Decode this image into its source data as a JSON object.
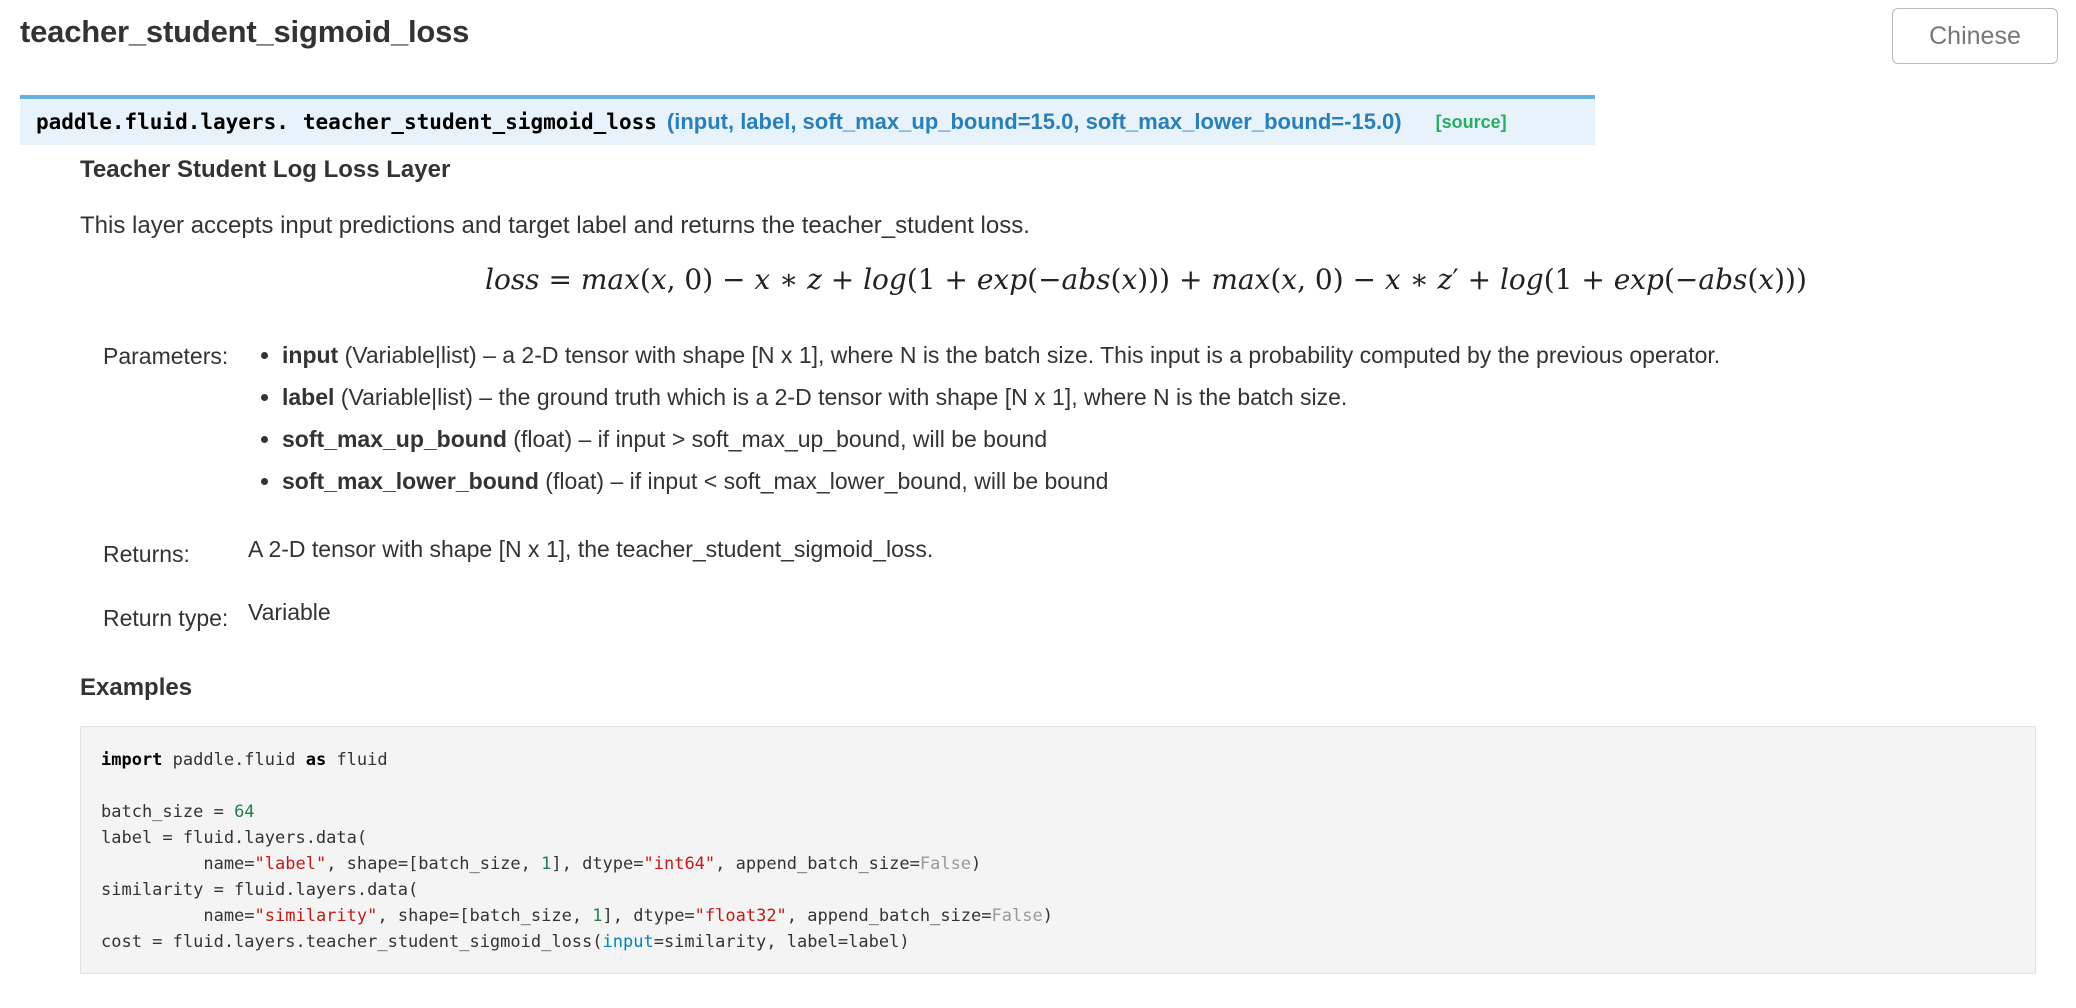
{
  "page": {
    "title": "teacher_student_sigmoid_loss",
    "language_button": "Chinese"
  },
  "signature": {
    "module": "paddle.fluid.layers.",
    "name": "teacher_student_sigmoid_loss",
    "params": "(input, label, soft_max_up_bound=15.0, soft_max_lower_bound=-15.0)",
    "source_link": "[source]"
  },
  "description": {
    "heading": "Teacher Student Log Loss Layer",
    "text": "This layer accepts input predictions and target label and returns the teacher_student loss."
  },
  "formula": "loss = max(x, 0) − x ∗ z + log(1 + exp(−abs(x))) + max(x, 0) − x ∗ z′ + log(1 + exp(−abs(x)))",
  "parameters": {
    "label": "Parameters:",
    "items": [
      {
        "name": "input",
        "desc": " (Variable|list) – a 2-D tensor with shape [N x 1], where N is the batch size. This input is a probability computed by the previous operator."
      },
      {
        "name": "label",
        "desc": " (Variable|list) – the ground truth which is a 2-D tensor with shape [N x 1], where N is the batch size."
      },
      {
        "name": "soft_max_up_bound",
        "desc": " (float) – if input > soft_max_up_bound, will be bound"
      },
      {
        "name": "soft_max_lower_bound",
        "desc": " (float) – if input < soft_max_lower_bound, will be bound"
      }
    ]
  },
  "returns": {
    "label": "Returns:",
    "value": "A 2-D tensor with shape [N x 1], the teacher_student_sigmoid_loss."
  },
  "return_type": {
    "label": "Return type:",
    "value": "Variable"
  },
  "examples": {
    "heading": "Examples",
    "code_lines": [
      "import paddle.fluid as fluid",
      "",
      "batch_size = 64",
      "label = fluid.layers.data(",
      "          name=\"label\", shape=[batch_size, 1], dtype=\"int64\", append_batch_size=False)",
      "similarity = fluid.layers.data(",
      "          name=\"similarity\", shape=[batch_size, 1], dtype=\"float32\", append_batch_size=False)",
      "cost = fluid.layers.teacher_student_sigmoid_loss(input=similarity, label=label)"
    ]
  }
}
